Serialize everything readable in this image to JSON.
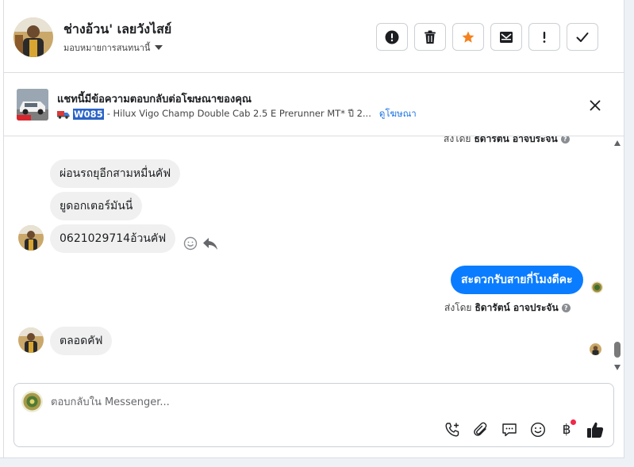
{
  "header": {
    "contact_name": "ช่างอ้วน' เลยวังไสย์",
    "assign_label": "มอบหมายการสนทนานี้",
    "actions": [
      {
        "name": "report-button",
        "icon": "alert-circle-icon"
      },
      {
        "name": "delete-button",
        "icon": "trash-icon"
      },
      {
        "name": "star-button",
        "icon": "star-icon"
      },
      {
        "name": "unread-button",
        "icon": "mail-icon"
      },
      {
        "name": "important-button",
        "icon": "exclamation-icon"
      },
      {
        "name": "done-button",
        "icon": "check-icon"
      }
    ]
  },
  "ad": {
    "title": "แชทนี้มีข้อความตอบกลับต่อโฆษณาของคุณ",
    "code": "W085",
    "description": " - Hilux Vigo Champ Double Cab 2.5 E Prerunner MT* ปี 2...",
    "link_label": "ดูโฆษณา"
  },
  "messages": {
    "sent_by_label": "ส่งโดย",
    "sender_name": "ธิดารัตน์ อาจประจัน",
    "incoming_1": "ผ่อนรถยุอีกสามหมื่นคัฟ",
    "incoming_2": "ยูดอกเตอร์มันนี่",
    "incoming_3": "0621029714อ้วนคัฟ",
    "outgoing_1": "สะดวกรับสายกี่โมงดีคะ",
    "incoming_4": "ตลอดคัฟ"
  },
  "composer": {
    "placeholder": "ตอบกลับใน Messenger..."
  },
  "colors": {
    "outgoing_bubble": "#0a7cff",
    "incoming_bubble": "#f0f0f0",
    "star": "#f5821f",
    "link": "#1b74e4",
    "notification_dot": "#f02849"
  }
}
